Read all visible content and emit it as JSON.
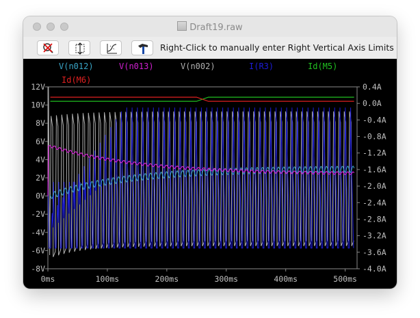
{
  "window": {
    "title": "Draft19.raw"
  },
  "toolbar": {
    "buttons": [
      "zoom-cancel-icon",
      "autorange-icon",
      "axis-limits-icon",
      "hammer-icon"
    ],
    "message": "Right-Click to manually enter Right Vertical Axis Limits"
  },
  "chart_data": {
    "type": "line",
    "x_ticks": [
      "0ms",
      "100ms",
      "200ms",
      "300ms",
      "400ms",
      "500ms"
    ],
    "x_range_ms": [
      0,
      520
    ],
    "left_axis_ticks": [
      "12V",
      "10V",
      "8V",
      "6V",
      "4V",
      "2V",
      "0V",
      "-2V",
      "-4V",
      "-6V",
      "-8V"
    ],
    "left_range_V": [
      -8,
      12
    ],
    "right_axis_ticks": [
      "0.4A",
      "0.0A",
      "-0.4A",
      "-0.8A",
      "-1.2A",
      "-1.6A",
      "-2.0A",
      "-2.4A",
      "-2.8A",
      "-3.2A",
      "-3.6A",
      "-4.0A"
    ],
    "right_range_A": [
      -4.0,
      0.4
    ],
    "grid": false,
    "series": [
      {
        "name": "V(n012)",
        "color": "#3aa6c8",
        "axis": "left",
        "start": 0,
        "end": 3
      },
      {
        "name": "V(n013)",
        "color": "#d020d0",
        "axis": "left",
        "start": 5.5,
        "end": 2.4
      },
      {
        "name": "V(n002)",
        "color": "#b0b0b0",
        "axis": "left",
        "high": 9.3,
        "low": -5.5,
        "periods": 57
      },
      {
        "name": "I(R3)",
        "color": "#1c1cd8",
        "axis": "right",
        "high": -0.1,
        "low": -3.5,
        "periods": 57
      },
      {
        "name": "Id(M5)",
        "color": "#20c020",
        "axis": "right",
        "value": 0.05
      },
      {
        "name": "Id(M6)",
        "color": "#e02020",
        "axis": "right",
        "value": 0.15
      }
    ]
  }
}
